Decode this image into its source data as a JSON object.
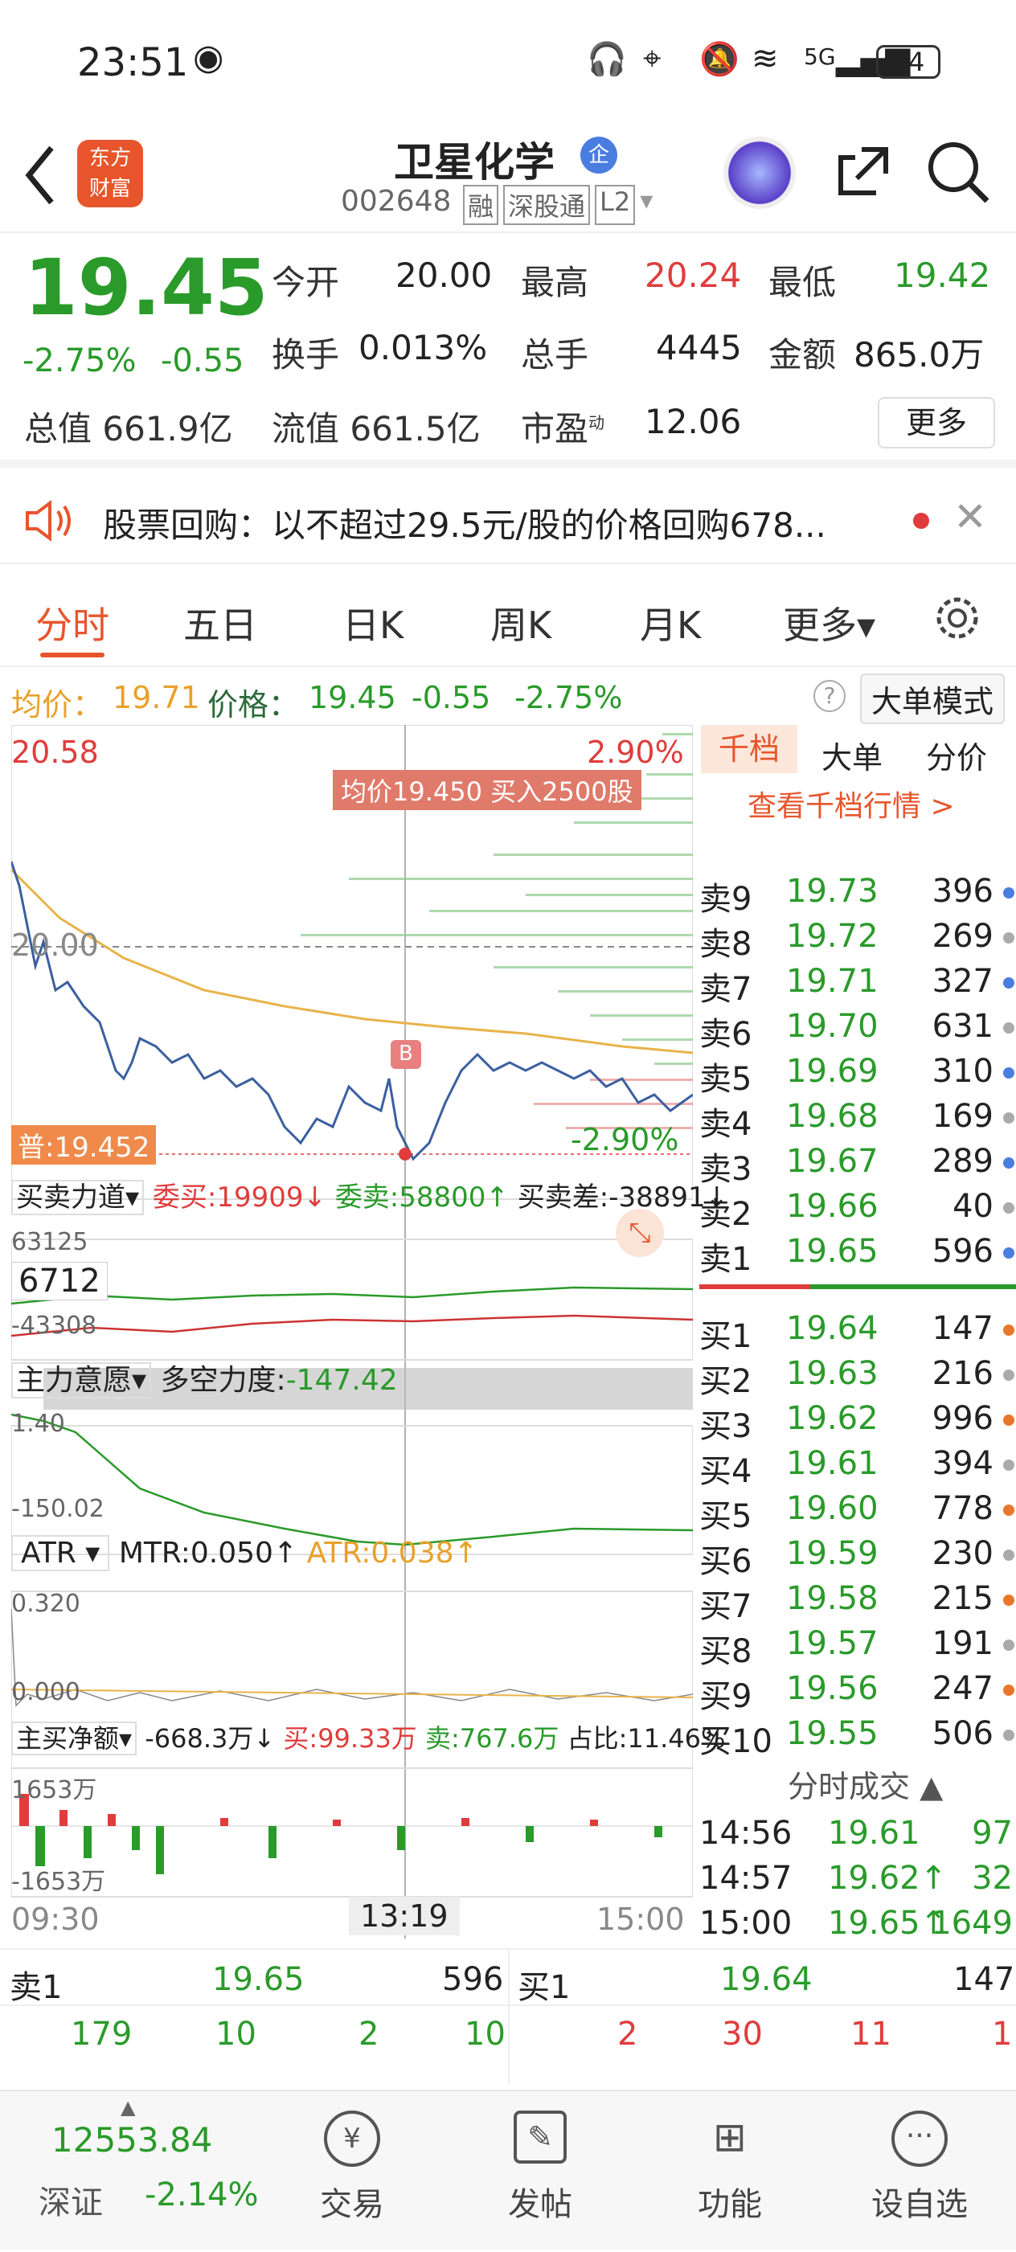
{
  "status": {
    "time": "23:51",
    "network": "5G",
    "battery": "34"
  },
  "header": {
    "title": "卫星化学",
    "badge": "企",
    "code": "002648",
    "tags": [
      "融",
      "深股通",
      "L2"
    ],
    "logo_line1": "东方",
    "logo_line2": "财富"
  },
  "quote": {
    "price": "19.45",
    "change_pct": "-2.75%",
    "change": "-0.55",
    "open_label": "今开",
    "open": "20.00",
    "high_label": "最高",
    "high": "20.24",
    "low_label": "最低",
    "low": "19.42",
    "turnover_label": "换手",
    "turnover": "0.013%",
    "vol_label": "总手",
    "vol": "4445",
    "amount_label": "金额",
    "amount": "865.0万",
    "mcap_label": "总值",
    "mcap": "661.9亿",
    "float_label": "流值",
    "float": "661.5亿",
    "pe_label": "市盈",
    "pe_sup": "动",
    "pe": "12.06",
    "more": "更多"
  },
  "notice": {
    "text": "股票回购：以不超过29.5元/股的价格回购678..."
  },
  "tabs": [
    "分时",
    "五日",
    "日K",
    "周K",
    "月K",
    "更多▾"
  ],
  "avgline": {
    "avg_label": "均价：",
    "avg": "19.71",
    "price_label": "价格：",
    "price": "19.45",
    "chg": "-0.55",
    "pct": "-2.75%",
    "mode": "大单模式"
  },
  "chart": {
    "top": "20.58",
    "top_pct": "2.90%",
    "mid": "20.00",
    "bottom_pct": "-2.90%",
    "tooltip": "均价19.450  买入2500股",
    "marker": "B",
    "pu": "普:19.452",
    "p1": {
      "name": "买卖力道",
      "label1": "委买:19909↓",
      "label2": "委卖:58800↑",
      "label3": "买卖差:-38891↓",
      "top": "63125",
      "box": "6712",
      "bottom": "-43308"
    },
    "p2": {
      "name": "主力意愿",
      "label": "多空力度:",
      "value": "-147.42",
      "top": "1.40",
      "bottom": "-150.02"
    },
    "p3": {
      "name": "ATR",
      "mtr": "MTR:0.050↑",
      "atr": "ATR:0.038↑",
      "top": "0.320",
      "bottom": "0.000"
    },
    "p4": {
      "name": "主买净额",
      "v": "-668.3万↓",
      "buy": "买:99.33万",
      "sell": "卖:767.6万",
      "ratio": "占比:11.46%",
      "top": "1653万",
      "bottom": "-1653万"
    },
    "times": [
      "09:30",
      "13:19",
      "15:00"
    ]
  },
  "book": {
    "tabs": [
      "千档",
      "大单",
      "分价"
    ],
    "link": "查看千档行情 >",
    "asks": [
      [
        "卖9",
        "19.73",
        "396"
      ],
      [
        "卖8",
        "19.72",
        "269"
      ],
      [
        "卖7",
        "19.71",
        "327"
      ],
      [
        "卖6",
        "19.70",
        "631"
      ],
      [
        "卖5",
        "19.69",
        "310"
      ],
      [
        "卖4",
        "19.68",
        "169"
      ],
      [
        "卖3",
        "19.67",
        "289"
      ],
      [
        "卖2",
        "19.66",
        "40"
      ],
      [
        "卖1",
        "19.65",
        "596"
      ]
    ],
    "bids": [
      [
        "买1",
        "19.64",
        "147"
      ],
      [
        "买2",
        "19.63",
        "216"
      ],
      [
        "买3",
        "19.62",
        "996"
      ],
      [
        "买4",
        "19.61",
        "394"
      ],
      [
        "买5",
        "19.60",
        "778"
      ],
      [
        "买6",
        "19.59",
        "230"
      ],
      [
        "买7",
        "19.58",
        "215"
      ],
      [
        "买8",
        "19.57",
        "191"
      ],
      [
        "买9",
        "19.56",
        "247"
      ],
      [
        "买10",
        "19.55",
        "506"
      ]
    ],
    "trades_title": "分时成交 ▲",
    "trades": [
      [
        "14:56",
        "19.61",
        "97"
      ],
      [
        "14:57",
        "19.62↑",
        "32"
      ],
      [
        "15:00",
        "19.65↑",
        "1649"
      ]
    ]
  },
  "level": {
    "ask_label": "卖1",
    "ask_price": "19.65",
    "ask_vol": "596",
    "bid_label": "买1",
    "bid_price": "19.64",
    "bid_vol": "147",
    "row2": [
      "179",
      "10",
      "2",
      "10",
      "2",
      "30",
      "11",
      "1"
    ]
  },
  "bottom": {
    "index": "12553.84",
    "index_name": "深证",
    "index_pct": "-2.14%",
    "items": [
      "交易",
      "发帖",
      "功能",
      "设自选"
    ]
  }
}
